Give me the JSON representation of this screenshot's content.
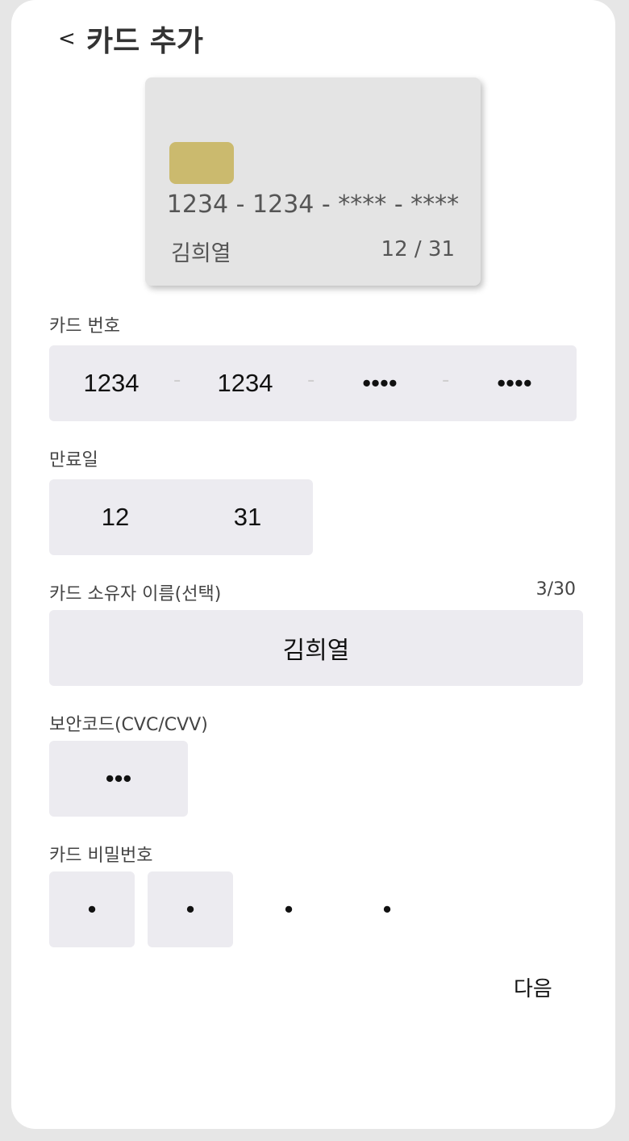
{
  "header": {
    "back_label": "<",
    "title": "카드 추가"
  },
  "card_preview": {
    "number": "1234 - 1234 - **** - ****",
    "owner": "김희열",
    "expiry": "12 / 31",
    "chip_color": "#cbba6e"
  },
  "card_number": {
    "label": "카드 번호",
    "segments": [
      "1234",
      "1234",
      "••••",
      "••••"
    ],
    "separator": "-"
  },
  "expiry": {
    "label": "만료일",
    "month": "12",
    "year": "31"
  },
  "owner_name": {
    "label": "카드 소유자 이름(선택)",
    "counter": "3/30",
    "value": "김희열"
  },
  "cvc": {
    "label": "보안코드(CVC/CVV)",
    "value": "•••"
  },
  "pin": {
    "label": "카드 비밀번호",
    "digits": [
      "•",
      "•",
      "•",
      "•"
    ]
  },
  "next_label": "다음"
}
